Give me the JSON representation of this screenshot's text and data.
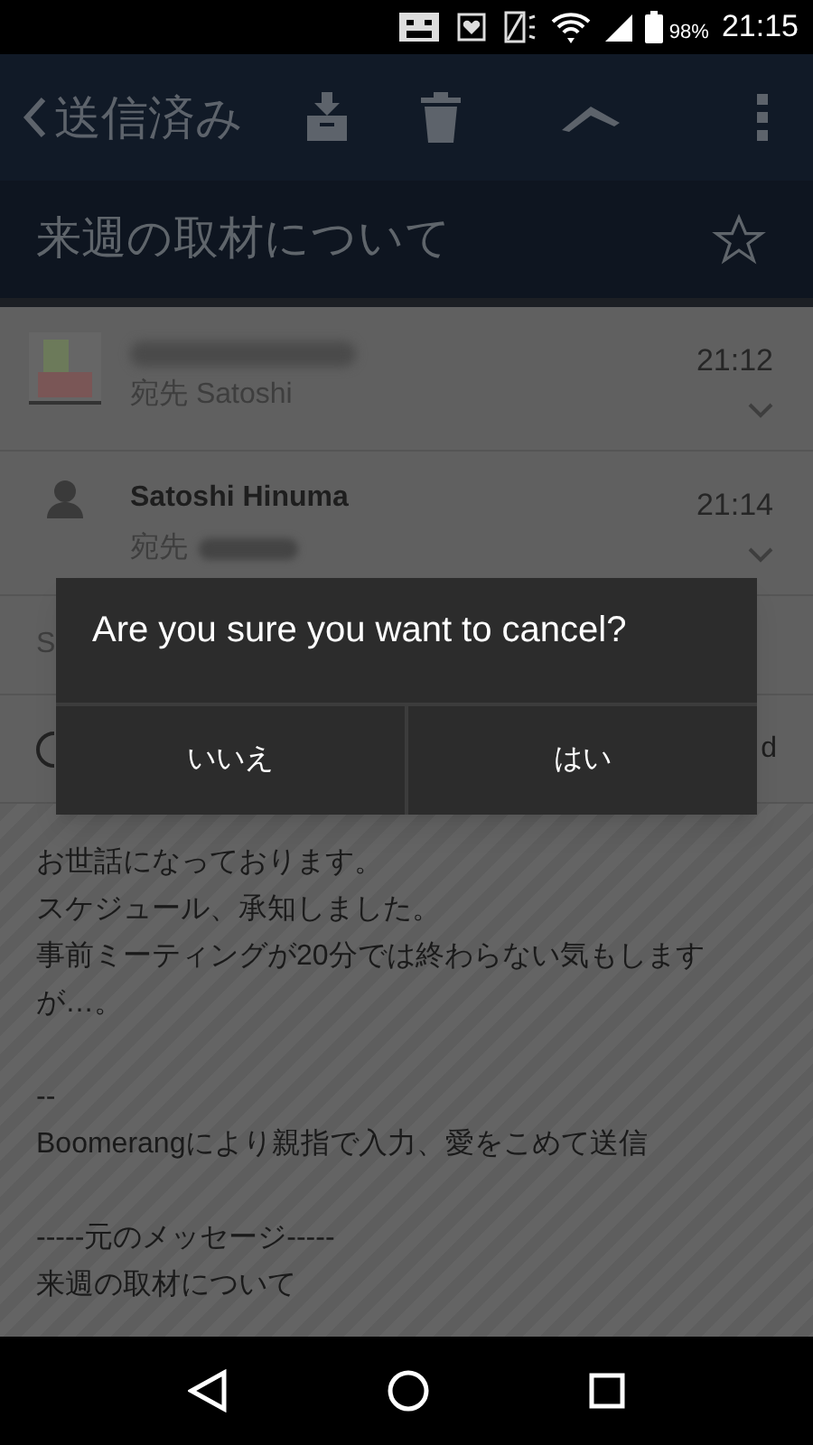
{
  "status_bar": {
    "battery": "98%",
    "time": "21:15"
  },
  "toolbar": {
    "back_label": "送信済み"
  },
  "subject": {
    "title": "来週の取材について",
    "starred": false
  },
  "messages": [
    {
      "kind": "picture",
      "recipient_label": "宛先",
      "recipient": "Satoshi",
      "time": "21:12"
    },
    {
      "kind": "person",
      "sender": "Satoshi Hinuma",
      "recipient_label": "宛先",
      "time": "21:14"
    }
  ],
  "row_3": {
    "text": "S"
  },
  "row_4": {
    "text": "d"
  },
  "body": [
    {
      "text": "お世話になっております。",
      "space_before": false
    },
    {
      "text": "スケジュール、承知しました。",
      "space_before": false
    },
    {
      "text": "事前ミーティングが20分では終わらない気もしますが…。",
      "space_before": false
    },
    {
      "text": "--",
      "space_before": true
    },
    {
      "text": "Boomerangにより親指で入力、愛をこめて送信",
      "space_before": false
    },
    {
      "text": "-----元のメッセージ-----",
      "space_before": true
    },
    {
      "text": "来週の取材について",
      "space_before": false
    }
  ],
  "dialog": {
    "message": "Are you sure you want to cancel?",
    "buttons": [
      "いいえ",
      "はい"
    ]
  }
}
